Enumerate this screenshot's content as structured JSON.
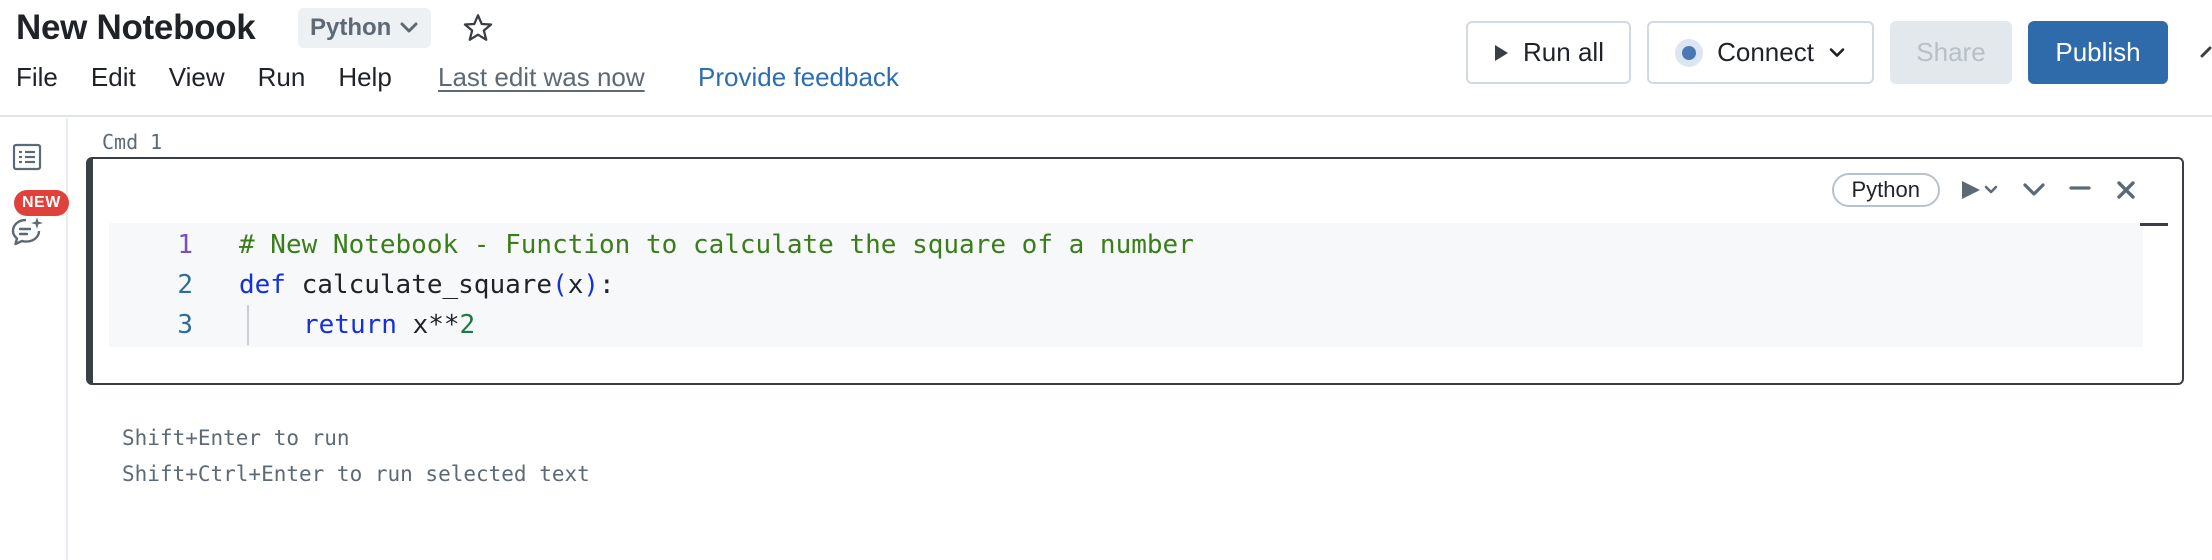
{
  "header": {
    "title": "New Notebook",
    "language": "Python",
    "menu": [
      "File",
      "Edit",
      "View",
      "Run",
      "Help"
    ],
    "last_edit": "Last edit was now",
    "feedback": "Provide feedback",
    "buttons": {
      "run_all": "Run all",
      "connect": "Connect",
      "share": "Share",
      "publish": "Publish"
    },
    "colors": {
      "publish": "#2f6bab",
      "feedback_link": "#2c6fb0",
      "new_badge": "#e0413a"
    }
  },
  "rail": {
    "new_badge": "NEW",
    "icons": [
      "table-of-contents-icon",
      "assistant-chat-icon"
    ]
  },
  "cell": {
    "label": "Cmd 1",
    "language": "Python",
    "lines": [
      {
        "number": "1",
        "text": "# New Notebook - Function to calculate the square of a number"
      },
      {
        "number": "2",
        "kw": "def",
        "fn": " calculate_square",
        "open": "(",
        "arg": "x",
        "close": ")",
        "end": ":"
      },
      {
        "number": "3",
        "kw": "return",
        "expr": " x**",
        "num": "2"
      }
    ]
  },
  "hints": {
    "run": "Shift+Enter to run",
    "run_selected": "Shift+Ctrl+Enter to run selected text"
  }
}
